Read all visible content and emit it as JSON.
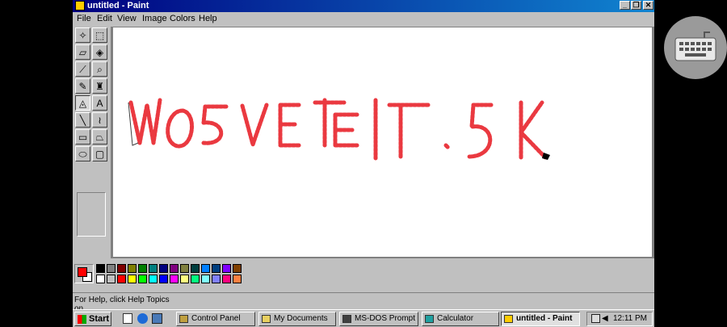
{
  "window": {
    "title": "untitled - Paint"
  },
  "menu": [
    "File",
    "Edit",
    "View",
    "Image",
    "Colors",
    "Help"
  ],
  "tools": [
    {
      "name": "free-select-tool",
      "glyph": "✧"
    },
    {
      "name": "rect-select-tool",
      "glyph": "⬚"
    },
    {
      "name": "eraser-tool",
      "glyph": "▱"
    },
    {
      "name": "fill-tool",
      "glyph": "◈"
    },
    {
      "name": "pick-color-tool",
      "glyph": "⟋"
    },
    {
      "name": "magnifier-tool",
      "glyph": "⌕"
    },
    {
      "name": "pencil-tool",
      "glyph": "✎"
    },
    {
      "name": "brush-tool",
      "glyph": "♜"
    },
    {
      "name": "airbrush-tool",
      "glyph": "◬"
    },
    {
      "name": "text-tool",
      "glyph": "A"
    },
    {
      "name": "line-tool",
      "glyph": "╲"
    },
    {
      "name": "curve-tool",
      "glyph": "≀"
    },
    {
      "name": "rectangle-tool",
      "glyph": "▭"
    },
    {
      "name": "polygon-tool",
      "glyph": "⏢"
    },
    {
      "name": "ellipse-tool",
      "glyph": "⬭"
    },
    {
      "name": "rounded-rect-tool",
      "glyph": "▢"
    }
  ],
  "active_tool": 8,
  "palette": {
    "foreground": "#ff0000",
    "background": "#ffffff",
    "row1": [
      "#000000",
      "#808080",
      "#800000",
      "#808000",
      "#008000",
      "#008080",
      "#000080",
      "#800080",
      "#808040",
      "#004040",
      "#0080ff",
      "#004080",
      "#8000ff",
      "#804000"
    ],
    "row2": [
      "#ffffff",
      "#c0c0c0",
      "#ff0000",
      "#ffff00",
      "#00ff00",
      "#00ffff",
      "#0000ff",
      "#ff00ff",
      "#ffff80",
      "#00ff80",
      "#80ffff",
      "#8080ff",
      "#ff0080",
      "#ff8040"
    ]
  },
  "status": {
    "text": "For Help, click Help Topics on..."
  },
  "taskbar": {
    "start": "Start",
    "buttons": [
      {
        "label": "Control Panel",
        "active": false
      },
      {
        "label": "My Documents",
        "active": false
      },
      {
        "label": "MS-DOS Prompt",
        "active": false
      },
      {
        "label": "Calculator",
        "active": false
      },
      {
        "label": "untitled - Paint",
        "active": true
      }
    ],
    "clock": "12:11 PM"
  }
}
